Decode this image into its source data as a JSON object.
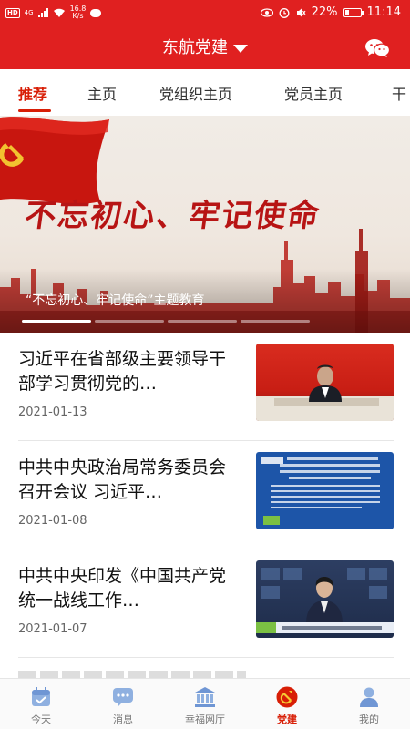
{
  "status_bar": {
    "hd": "HD",
    "signal": "4G",
    "speed_value": "16.8",
    "speed_unit": "K/s",
    "battery": "22%",
    "time": "11:14",
    "icons": [
      "wifi-icon",
      "message-icon",
      "eye-icon",
      "alarm-icon",
      "mute-icon",
      "battery-icon"
    ]
  },
  "header": {
    "title": "东航党建",
    "dropdown_icon": "caret-down-icon",
    "action_icon": "wechat-icon"
  },
  "tabs": [
    {
      "label": "推荐",
      "active": true
    },
    {
      "label": "主页",
      "active": false
    },
    {
      "label": "党组织主页",
      "active": false
    },
    {
      "label": "党员主页",
      "active": false
    },
    {
      "label": "干",
      "active": false
    }
  ],
  "banner": {
    "slogan": "不忘初心、牢记使命",
    "caption": "“不忘初心、牢记使命”主题教育",
    "slides": 4,
    "active_slide": 1
  },
  "news": [
    {
      "title": "习近平在省部级主要领导干部学习贯彻党的…",
      "date": "2021-01-13"
    },
    {
      "title": "中共中央政治局常务委员会召开会议 习近平…",
      "date": "2021-01-08"
    },
    {
      "title": "中共中央印发《中国共产党统一战线工作…",
      "date": "2021-01-07"
    }
  ],
  "bottom_nav": [
    {
      "label": "今天",
      "icon": "calendar-icon",
      "active": false
    },
    {
      "label": "消息",
      "icon": "chat-icon",
      "active": false
    },
    {
      "label": "幸福网厅",
      "icon": "hall-icon",
      "active": false
    },
    {
      "label": "党建",
      "icon": "party-emblem-icon",
      "active": true
    },
    {
      "label": "我的",
      "icon": "user-icon",
      "active": false
    }
  ],
  "colors": {
    "brand_red": "#e02020",
    "active_red": "#d81e06"
  }
}
